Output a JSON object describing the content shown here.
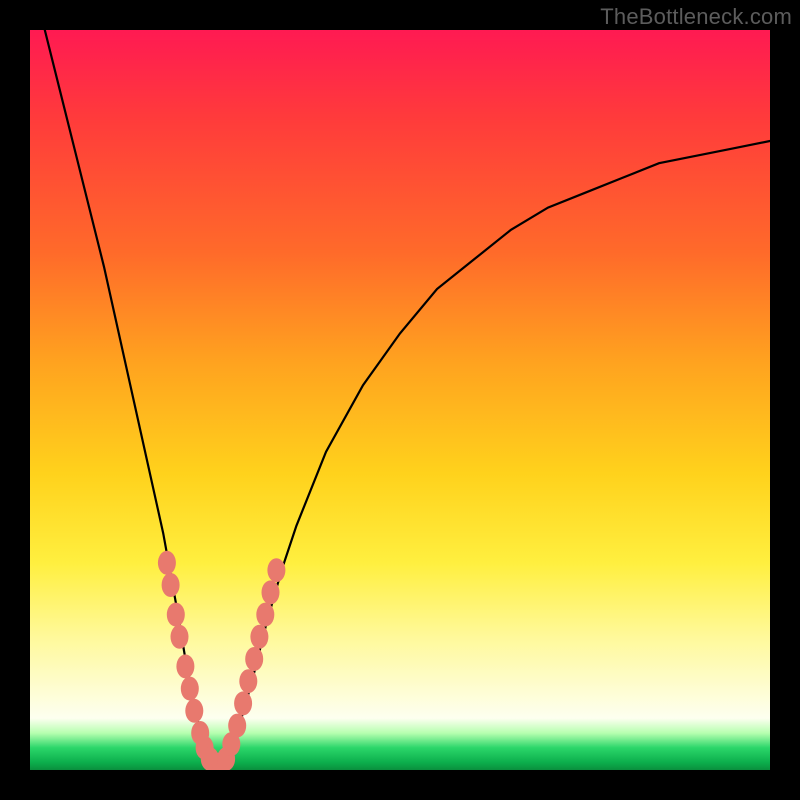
{
  "watermark": "TheBottleneck.com",
  "chart_data": {
    "type": "line",
    "title": "",
    "xlabel": "",
    "ylabel": "",
    "xlim": [
      0,
      100
    ],
    "ylim": [
      0,
      100
    ],
    "series": [
      {
        "name": "bottleneck-curve",
        "x": [
          2,
          4,
          6,
          8,
          10,
          12,
          14,
          16,
          18,
          20,
          21,
          22,
          23,
          24,
          25,
          26,
          27,
          28,
          30,
          32,
          34,
          36,
          40,
          45,
          50,
          55,
          60,
          65,
          70,
          75,
          80,
          85,
          90,
          95,
          100
        ],
        "y": [
          100,
          92,
          84,
          76,
          68,
          59,
          50,
          41,
          32,
          21,
          15,
          10,
          5,
          2,
          0,
          0,
          2,
          5,
          12,
          20,
          27,
          33,
          43,
          52,
          59,
          65,
          69,
          73,
          76,
          78,
          80,
          82,
          83,
          84,
          85
        ]
      }
    ],
    "markers": {
      "name": "highlight-dots",
      "color": "#e8796e",
      "points": [
        {
          "x": 18.5,
          "y": 28
        },
        {
          "x": 19.0,
          "y": 25
        },
        {
          "x": 19.7,
          "y": 21
        },
        {
          "x": 20.2,
          "y": 18
        },
        {
          "x": 21.0,
          "y": 14
        },
        {
          "x": 21.6,
          "y": 11
        },
        {
          "x": 22.2,
          "y": 8
        },
        {
          "x": 23.0,
          "y": 5
        },
        {
          "x": 23.6,
          "y": 3
        },
        {
          "x": 24.3,
          "y": 1.5
        },
        {
          "x": 25.0,
          "y": 0.8
        },
        {
          "x": 25.8,
          "y": 0.8
        },
        {
          "x": 26.5,
          "y": 1.5
        },
        {
          "x": 27.2,
          "y": 3.5
        },
        {
          "x": 28.0,
          "y": 6
        },
        {
          "x": 28.8,
          "y": 9
        },
        {
          "x": 29.5,
          "y": 12
        },
        {
          "x": 30.3,
          "y": 15
        },
        {
          "x": 31.0,
          "y": 18
        },
        {
          "x": 31.8,
          "y": 21
        },
        {
          "x": 32.5,
          "y": 24
        },
        {
          "x": 33.3,
          "y": 27
        }
      ]
    },
    "gradient_stops": [
      {
        "pos": 0,
        "color": "#ff1a52"
      },
      {
        "pos": 12,
        "color": "#ff3b3b"
      },
      {
        "pos": 30,
        "color": "#ff6a2a"
      },
      {
        "pos": 45,
        "color": "#ffa31f"
      },
      {
        "pos": 60,
        "color": "#ffd21c"
      },
      {
        "pos": 72,
        "color": "#ffef3f"
      },
      {
        "pos": 82,
        "color": "#fff99a"
      },
      {
        "pos": 93,
        "color": "#fdfff0"
      },
      {
        "pos": 95,
        "color": "#b7ffb0"
      },
      {
        "pos": 97,
        "color": "#2bd66a"
      },
      {
        "pos": 99,
        "color": "#0cae4c"
      },
      {
        "pos": 100,
        "color": "#0a8f3d"
      }
    ]
  }
}
